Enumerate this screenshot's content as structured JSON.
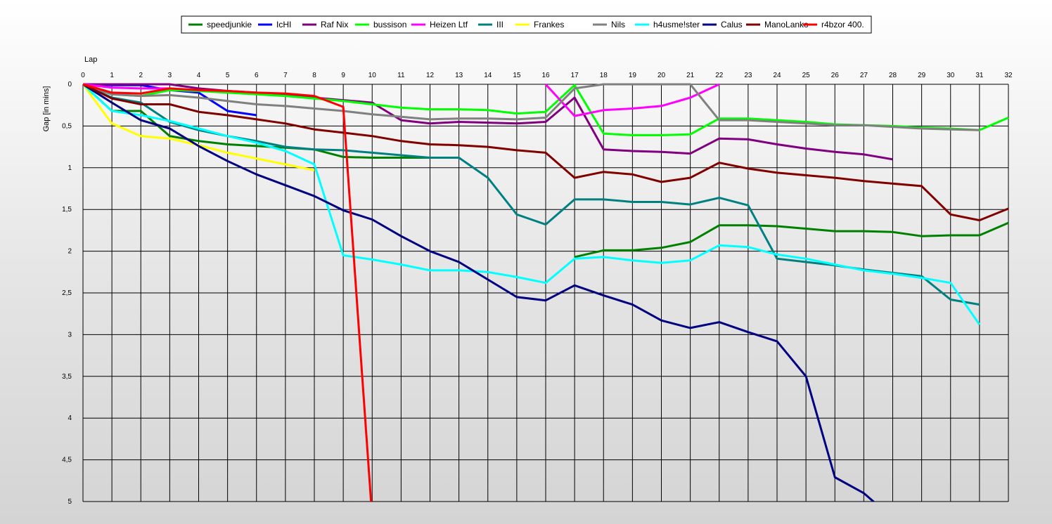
{
  "chart_data": {
    "type": "line",
    "xlabel": "Lap",
    "ylabel": "Gap [in mins]",
    "x": [
      0,
      1,
      2,
      3,
      4,
      5,
      6,
      7,
      8,
      9,
      10,
      11,
      12,
      13,
      14,
      15,
      16,
      17,
      18,
      19,
      20,
      21,
      22,
      23,
      24,
      25,
      26,
      27,
      28,
      29,
      30,
      31,
      32
    ],
    "xlim": [
      0,
      32
    ],
    "ylim": [
      0,
      5
    ],
    "y_inverted": true,
    "y_ticks": [
      "0",
      "0,5",
      "1",
      "1,5",
      "2",
      "2,5",
      "3",
      "3,5",
      "4",
      "4,5",
      "5"
    ],
    "y_tick_values": [
      0,
      0.5,
      1,
      1.5,
      2,
      2.5,
      3,
      3.5,
      4,
      4.5,
      5
    ],
    "grid": true,
    "legend_position": "top-center",
    "series": [
      {
        "name": "speedjunkie",
        "color": "#008000",
        "values": [
          0,
          0.32,
          0.32,
          0.62,
          0.68,
          0.72,
          0.74,
          0.76,
          0.78,
          0.87,
          0.88,
          0.88,
          0.88,
          0.88,
          null,
          null,
          null,
          2.07,
          1.99,
          1.99,
          1.96,
          1.89,
          1.69,
          1.69,
          1.7,
          1.73,
          1.76,
          1.76,
          1.77,
          1.82,
          1.81,
          1.81,
          1.66
        ]
      },
      {
        "name": "IcHI",
        "color": "#0000ff",
        "values": [
          0,
          0.01,
          0.01,
          0.07,
          0.1,
          0.32,
          0.37
        ]
      },
      {
        "name": "Raf Nix",
        "color": "#800080",
        "values": [
          0,
          0,
          0,
          0,
          0.05,
          0.08,
          0.1,
          0.13,
          0.16,
          0.19,
          0.22,
          0.43,
          0.47,
          0.45,
          0.46,
          0.47,
          0.45,
          0.16,
          0.78,
          0.8,
          0.81,
          0.83,
          0.65,
          0.66,
          0.72,
          0.77,
          0.81,
          0.84,
          0.9
        ]
      },
      {
        "name": "bussison",
        "color": "#00ff00",
        "values": [
          0,
          0.12,
          0.14,
          0.07,
          0.08,
          0.1,
          0.12,
          0.14,
          0.17,
          0.2,
          0.24,
          0.28,
          0.3,
          0.3,
          0.31,
          0.35,
          0.33,
          0.01,
          0.59,
          0.61,
          0.61,
          0.6,
          0.41,
          0.41,
          0.43,
          0.45,
          0.48,
          0.49,
          0.5,
          0.52,
          0.53,
          0.55,
          0.4
        ]
      },
      {
        "name": "Heizen Ltf",
        "color": "#ff00ff",
        "values": [
          0,
          0.04,
          0.05,
          0.05,
          null,
          null,
          null,
          null,
          null,
          null,
          null,
          null,
          null,
          null,
          null,
          null,
          0,
          0.38,
          0.31,
          0.29,
          0.26,
          0.16,
          0
        ]
      },
      {
        "name": "III",
        "color": "#008080",
        "values": [
          0,
          0.16,
          0.22,
          0.45,
          0.55,
          0.62,
          0.68,
          0.75,
          0.78,
          0.79,
          0.82,
          0.85,
          0.88,
          0.88,
          1.12,
          1.56,
          1.68,
          1.38,
          1.38,
          1.41,
          1.41,
          1.44,
          1.36,
          1.45,
          2.09,
          2.13,
          2.17,
          2.22,
          2.26,
          2.3,
          2.58,
          2.64
        ]
      },
      {
        "name": "Frankes",
        "color": "#ffff00",
        "values": [
          0,
          0.47,
          0.62,
          0.65,
          0.73,
          0.82,
          0.89,
          0.96,
          1.03
        ]
      },
      {
        "name": "Nils",
        "color": "#808080",
        "values": [
          0,
          0.12,
          0.14,
          0.13,
          0.16,
          0.2,
          0.24,
          0.26,
          0.29,
          0.32,
          0.36,
          0.39,
          0.42,
          0.41,
          0.41,
          0.42,
          0.4,
          0.05,
          0,
          0,
          0,
          0,
          0.43,
          0.43,
          0.45,
          0.47,
          0.49,
          0.49,
          0.51,
          0.53,
          0.54,
          0.55
        ]
      },
      {
        "name": "h4usme!ster",
        "color": "#00ffff",
        "values": [
          0,
          0.32,
          0.37,
          0.44,
          0.53,
          0.62,
          0.7,
          0.8,
          0.96,
          2.05,
          2.1,
          2.16,
          2.23,
          2.23,
          2.25,
          2.31,
          2.38,
          2.09,
          2.07,
          2.11,
          2.14,
          2.11,
          1.93,
          1.95,
          2.04,
          2.09,
          2.16,
          2.23,
          2.27,
          2.32,
          2.38,
          2.88
        ]
      },
      {
        "name": "Calus",
        "color": "#000080",
        "values": [
          0,
          0.22,
          0.43,
          0.53,
          0.74,
          0.92,
          1.08,
          1.21,
          1.34,
          1.51,
          1.62,
          1.82,
          2.0,
          2.13,
          2.34,
          2.55,
          2.59,
          2.41,
          2.53,
          2.64,
          2.83,
          2.92,
          2.85,
          2.97,
          3.08,
          3.5,
          4.71,
          4.9,
          5.2
        ]
      },
      {
        "name": "ManoLanko",
        "color": "#800000",
        "values": [
          0,
          0.17,
          0.24,
          0.24,
          0.33,
          0.37,
          0.42,
          0.47,
          0.54,
          0.58,
          0.62,
          0.68,
          0.72,
          0.73,
          0.75,
          0.79,
          0.82,
          1.12,
          1.05,
          1.08,
          1.17,
          1.12,
          0.94,
          1.01,
          1.06,
          1.09,
          1.12,
          1.16,
          1.19,
          1.22,
          1.56,
          1.63,
          1.49
        ]
      },
      {
        "name": "r4bzor 400.",
        "color": "#ff0000",
        "values": [
          0,
          0.1,
          0.11,
          0.05,
          0.07,
          0.08,
          0.1,
          0.11,
          0.14,
          0.27,
          5.2
        ]
      }
    ]
  }
}
